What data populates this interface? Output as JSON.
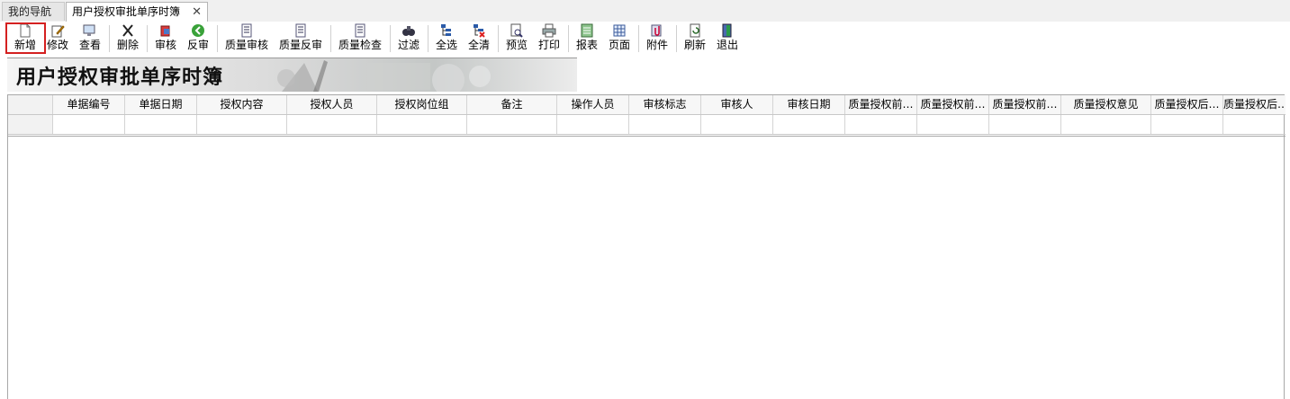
{
  "tabs": [
    {
      "label": "我的导航"
    },
    {
      "label": "用户授权审批单序时簿",
      "close": "✕"
    }
  ],
  "toolbar": {
    "new": "新增",
    "edit": "修改",
    "view": "查看",
    "delete": "删除",
    "audit": "审核",
    "unaudit": "反审",
    "quality_audit": "质量审核",
    "quality_unaudit": "质量反审",
    "quality_check": "质量检查",
    "filter": "过滤",
    "select_all": "全选",
    "clear_all": "全清",
    "preview": "预览",
    "print": "打印",
    "report": "报表",
    "page": "页面",
    "attachment": "附件",
    "refresh": "刷新",
    "exit": "退出"
  },
  "banner": {
    "title": "用户授权审批单序时簿"
  },
  "grid": {
    "columns": [
      "单据编号",
      "单据日期",
      "授权内容",
      "授权人员",
      "授权岗位组",
      "备注",
      "操作人员",
      "审核标志",
      "审核人",
      "审核日期",
      "质量授权前…",
      "质量授权前…",
      "质量授权前…",
      "质量授权意见",
      "质量授权后…",
      "质量授权后…"
    ]
  }
}
